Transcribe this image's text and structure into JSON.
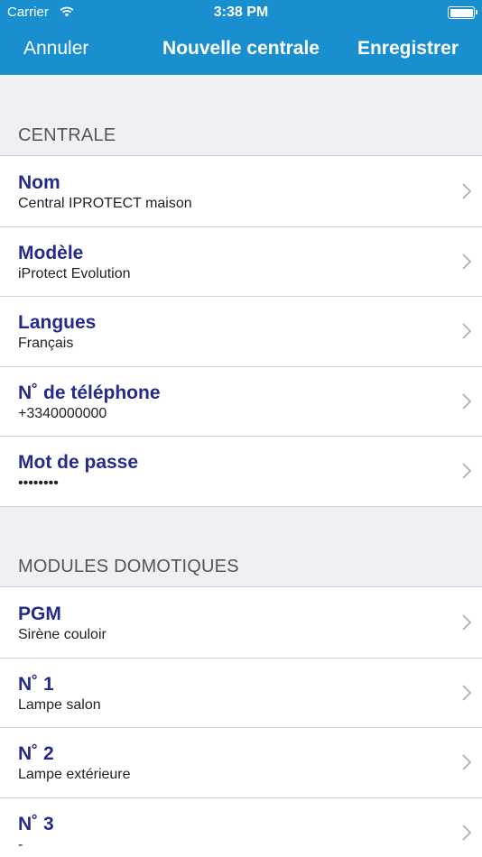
{
  "status": {
    "carrier": "Carrier",
    "time": "3:38 PM"
  },
  "nav": {
    "cancel": "Annuler",
    "title": "Nouvelle centrale",
    "save": "Enregistrer"
  },
  "sections": [
    {
      "header": "CENTRALE",
      "rows": [
        {
          "title": "Nom",
          "value": "Central IPROTECT maison"
        },
        {
          "title": "Modèle",
          "value": "iProtect Evolution"
        },
        {
          "title": "Langues",
          "value": "Français"
        },
        {
          "title": "N˚ de téléphone",
          "value": "+3340000000"
        },
        {
          "title": "Mot de passe",
          "value": "••••••••"
        }
      ]
    },
    {
      "header": "MODULES DOMOTIQUES",
      "rows": [
        {
          "title": "PGM",
          "value": "Sirène couloir"
        },
        {
          "title": "N˚ 1",
          "value": "Lampe salon"
        },
        {
          "title": "N˚ 2",
          "value": "Lampe extérieure"
        },
        {
          "title": "N˚ 3",
          "value": "-"
        }
      ]
    }
  ],
  "colors": {
    "nav_bar": "#1a8fd0",
    "row_title": "#252b8c",
    "background": "#efeff4"
  }
}
